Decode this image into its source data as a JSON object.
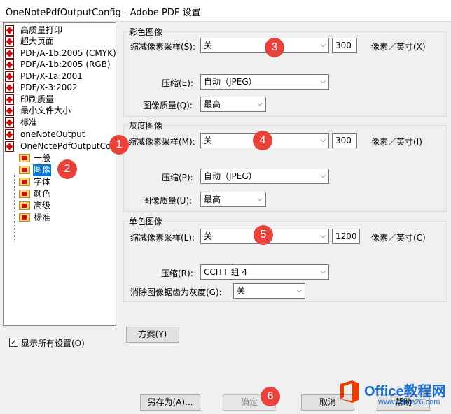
{
  "window": {
    "title": "OneNotePdfOutputConfig - Adobe PDF 设置"
  },
  "tree": {
    "presets": [
      "高质量打印",
      "超大页面",
      "PDF/A-1b:2005 (CMYK)",
      "PDF/A-1b:2005 (RGB)",
      "PDF/X-1a:2001",
      "PDF/X-3:2002",
      "印刷质量",
      "最小文件大小",
      "标准",
      "oneNoteOutput",
      "OneNotePdfOutputConfig"
    ],
    "children": [
      "一般",
      "图像",
      "字体",
      "颜色",
      "高级",
      "标准"
    ]
  },
  "color_images": {
    "title": "彩色图像",
    "downsample_label": "缩减像素采样(S):",
    "downsample_value": "关",
    "ppi_value": "300",
    "ppi_unit": "像素／英寸(X)",
    "compression_label": "压缩(E):",
    "compression_value": "自动（JPEG）",
    "quality_label": "图像质量(Q):",
    "quality_value": "最高"
  },
  "gray_images": {
    "title": "灰度图像",
    "downsample_label": "缩减像素采样(M):",
    "downsample_value": "关",
    "ppi_value": "300",
    "ppi_unit": "像素／英寸(I)",
    "compression_label": "压缩(P):",
    "compression_value": "自动（JPEG）",
    "quality_label": "图像质量(U):",
    "quality_value": "最高"
  },
  "mono_images": {
    "title": "单色图像",
    "downsample_label": "缩减像素采样(L):",
    "downsample_value": "关",
    "ppi_value": "1200",
    "ppi_unit": "像素／英寸(C)",
    "compression_label": "压缩(R):",
    "compression_value": "CCITT 组 4",
    "antialias_label": "消除图像锯齿为灰度(G):",
    "antialias_value": "关"
  },
  "footer": {
    "show_all_label": "显示所有设置(O)",
    "show_all_checked": true,
    "scheme_button": "方案(Y)",
    "save_as_button": "另存为(A)...",
    "ok_button": "确定",
    "cancel_button": "取消",
    "help_button": "帮助"
  },
  "badges": [
    "1",
    "2",
    "3",
    "4",
    "5",
    "6"
  ],
  "watermark": {
    "title": "Office教程网",
    "url": "www.office26.com"
  },
  "colors": {
    "badge": "#e8423a",
    "selection": "#0078d7",
    "watermark": "#1a6fcf"
  },
  "icons": {
    "preset": "pdf-settings-icon",
    "child": "folder-icon",
    "chevron": "chevron-down-icon"
  }
}
